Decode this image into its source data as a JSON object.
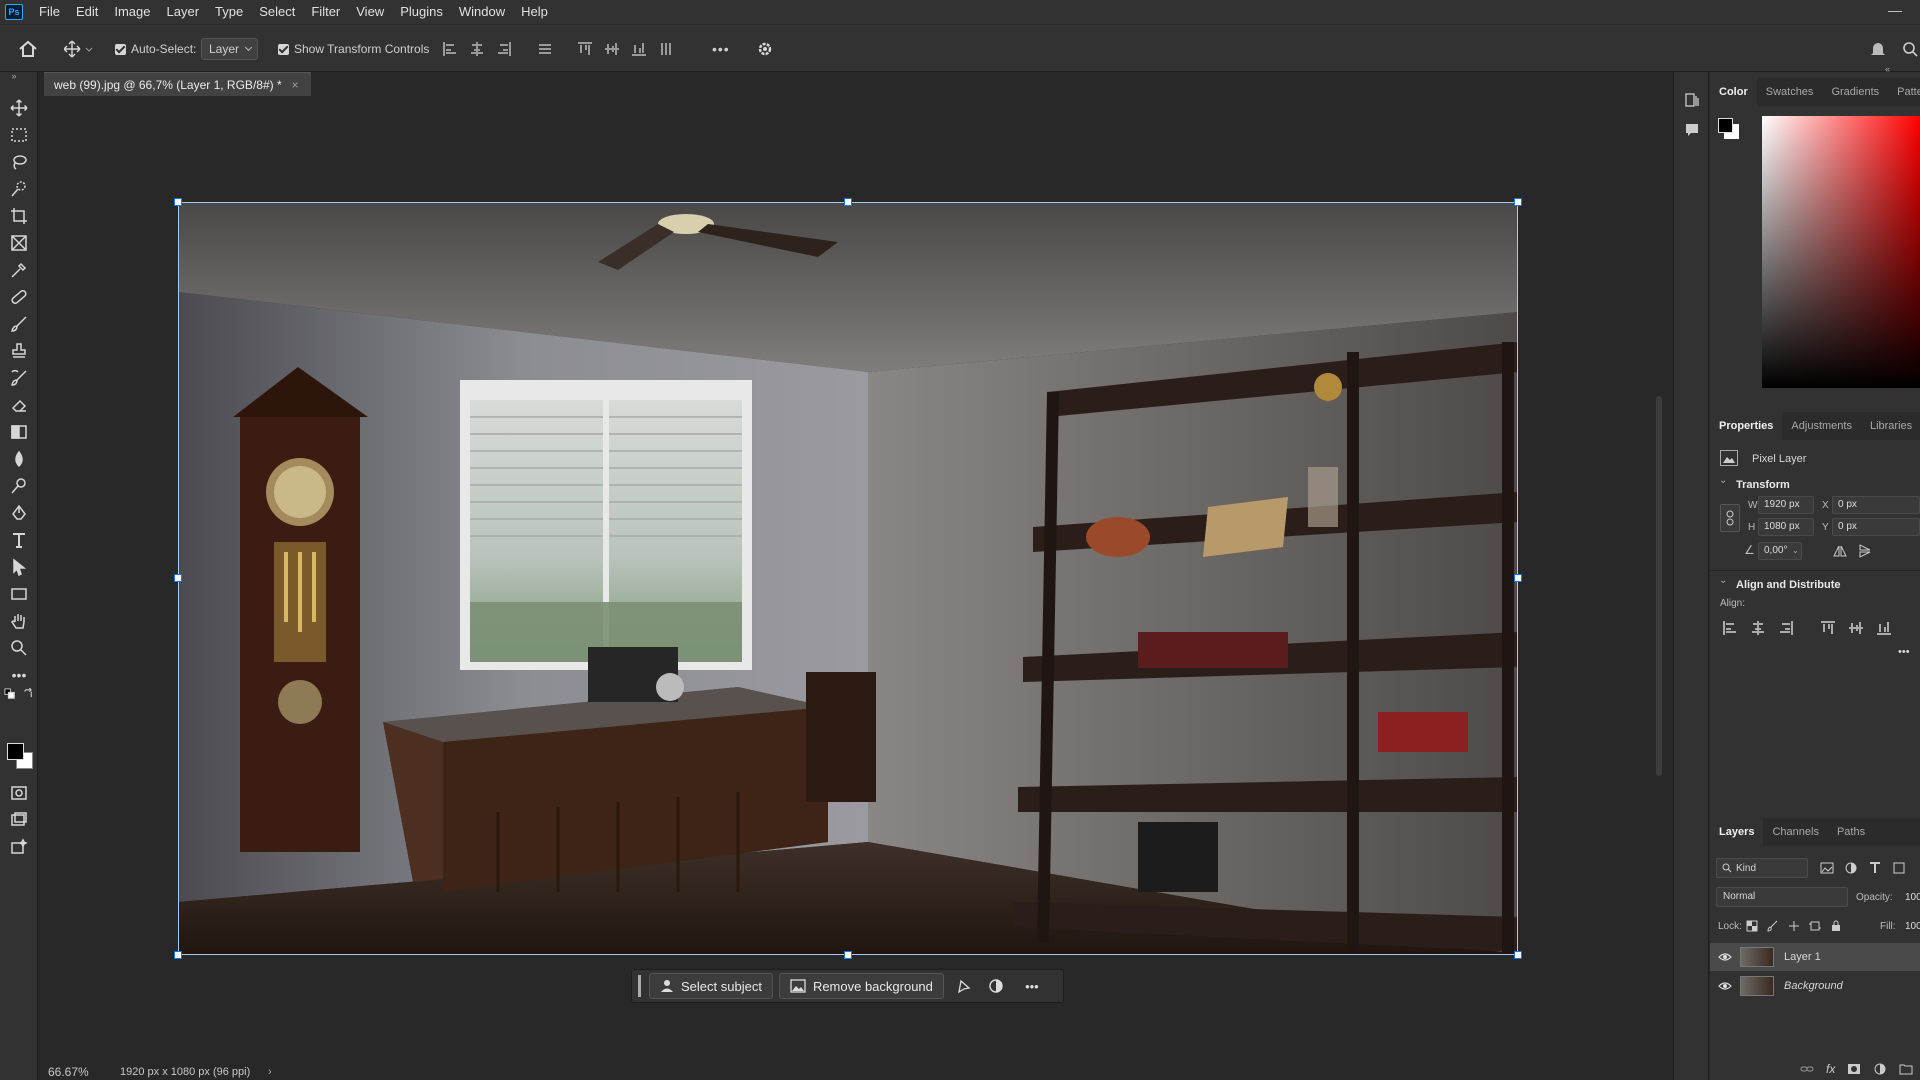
{
  "menu": [
    "File",
    "Edit",
    "Image",
    "Layer",
    "Type",
    "Select",
    "Filter",
    "View",
    "Plugins",
    "Window",
    "Help"
  ],
  "app_logo": "Ps",
  "window_minimize": "—",
  "options": {
    "auto_select_label": "Auto-Select:",
    "auto_select_target": "Layer",
    "show_transform_label": "Show Transform Controls",
    "more_label": "•••"
  },
  "document": {
    "tab_title": "web (99).jpg @ 66,7% (Layer 1, RGB/8#) *",
    "close": "×"
  },
  "context_bar": {
    "select_subject": "Select subject",
    "remove_background": "Remove background",
    "more": "•••"
  },
  "status": {
    "zoom": "66.67%",
    "doc_info": "1920 px x 1080 px (96 ppi)",
    "arrow": "›"
  },
  "color_panel": {
    "tabs": [
      "Color",
      "Swatches",
      "Gradients",
      "Patte"
    ],
    "foreground": "#000000",
    "background": "#ffffff",
    "hue": "#ff0000"
  },
  "properties_panel": {
    "tabs": [
      "Properties",
      "Adjustments",
      "Libraries"
    ],
    "layer_type": "Pixel Layer",
    "transform_title": "Transform",
    "w_label": "W",
    "w_value": "1920 px",
    "h_label": "H",
    "h_value": "1080 px",
    "x_label": "X",
    "x_value": "0 px",
    "y_label": "Y",
    "y_value": "0 px",
    "angle_value": "0,00°",
    "align_title": "Align and Distribute",
    "align_label": "Align:",
    "more": "•••"
  },
  "layers_panel": {
    "tabs": [
      "Layers",
      "Channels",
      "Paths"
    ],
    "filter_kind": "Kind",
    "blend_mode": "Normal",
    "opacity_label": "Opacity:",
    "opacity_value": "100",
    "lock_label": "Lock:",
    "fill_label": "Fill:",
    "fill_value": "100",
    "layers": [
      {
        "name": "Layer 1",
        "selected": true
      },
      {
        "name": "Background",
        "selected": false
      }
    ]
  }
}
